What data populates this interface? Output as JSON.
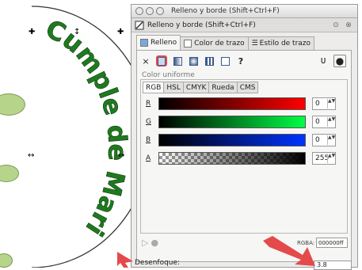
{
  "canvas": {
    "arc_text": "Cumple de Mari",
    "handle_glyphs": [
      "✚",
      "↕",
      "↔"
    ]
  },
  "window": {
    "title": "Relleno y borde (Shift+Ctrl+F)",
    "dock_title": "Relleno y borde (Shift+Ctrl+F)"
  },
  "tabs": [
    {
      "label": "Relleno",
      "active": true
    },
    {
      "label": "Color de trazo",
      "active": false
    },
    {
      "label": "Estilo de trazo",
      "active": false
    }
  ],
  "paint_modes": {
    "none_glyph": "×",
    "unset_glyph": "?",
    "evenodd_glyph": "ᴜ",
    "nonzero_glyph": "●"
  },
  "uniform_label": "Color uniforme",
  "color_tabs": [
    {
      "label": "RGB",
      "active": true
    },
    {
      "label": "HSL",
      "active": false
    },
    {
      "label": "CMYK",
      "active": false
    },
    {
      "label": "Rueda",
      "active": false
    },
    {
      "label": "CMS",
      "active": false
    }
  ],
  "sliders": [
    {
      "label": "R",
      "value": "0",
      "color": "#ff0000"
    },
    {
      "label": "G",
      "value": "0",
      "color": "#00ff44"
    },
    {
      "label": "B",
      "value": "0",
      "color": "#0033ff"
    },
    {
      "label": "A",
      "value": "255",
      "color": "#000000"
    }
  ],
  "spin_glyph": "▲▼",
  "rgba": {
    "label": "RGBA:",
    "value": "000000ff"
  },
  "blur": {
    "label": "Desenfoque:",
    "value": "3.8"
  },
  "colors": {
    "arc_text": "#1f7a1f",
    "highlight": "#e44a4a"
  }
}
